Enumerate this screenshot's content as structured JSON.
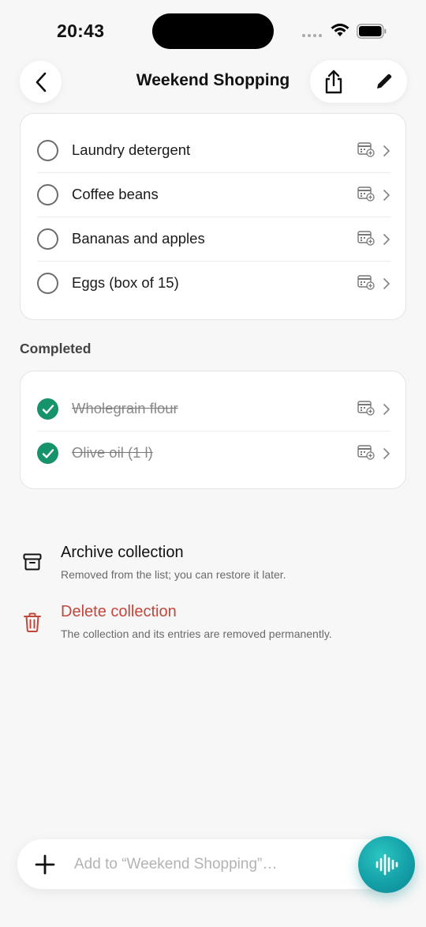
{
  "status_bar": {
    "time": "20:43"
  },
  "nav": {
    "title": "Weekend Shopping"
  },
  "items": [
    {
      "label": "Laundry detergent"
    },
    {
      "label": "Coffee beans"
    },
    {
      "label": "Bananas and apples"
    },
    {
      "label": "Eggs (box of 15)"
    }
  ],
  "completed": {
    "heading": "Completed",
    "items": [
      {
        "label": "Wholegrain flour"
      },
      {
        "label": "Olive oil (1 l)"
      }
    ]
  },
  "actions": {
    "archive": {
      "title": "Archive collection",
      "subtitle": "Removed from the list; you can restore it later."
    },
    "delete": {
      "title": "Delete collection",
      "subtitle": "The collection and its entries are removed permanently."
    }
  },
  "input": {
    "placeholder": "Add to “Weekend Shopping”…"
  },
  "colors": {
    "accent_green": "#17936c",
    "danger": "#c0473c",
    "voice_teal": "#14a0a8"
  },
  "icons": {
    "back": "chevron-left-icon",
    "share": "share-icon",
    "edit": "pencil-icon",
    "calendar": "calendar-add-icon",
    "chevron": "chevron-right-icon",
    "archive": "archive-box-icon",
    "delete": "trash-icon",
    "add": "plus-icon",
    "voice": "waveform-icon"
  }
}
